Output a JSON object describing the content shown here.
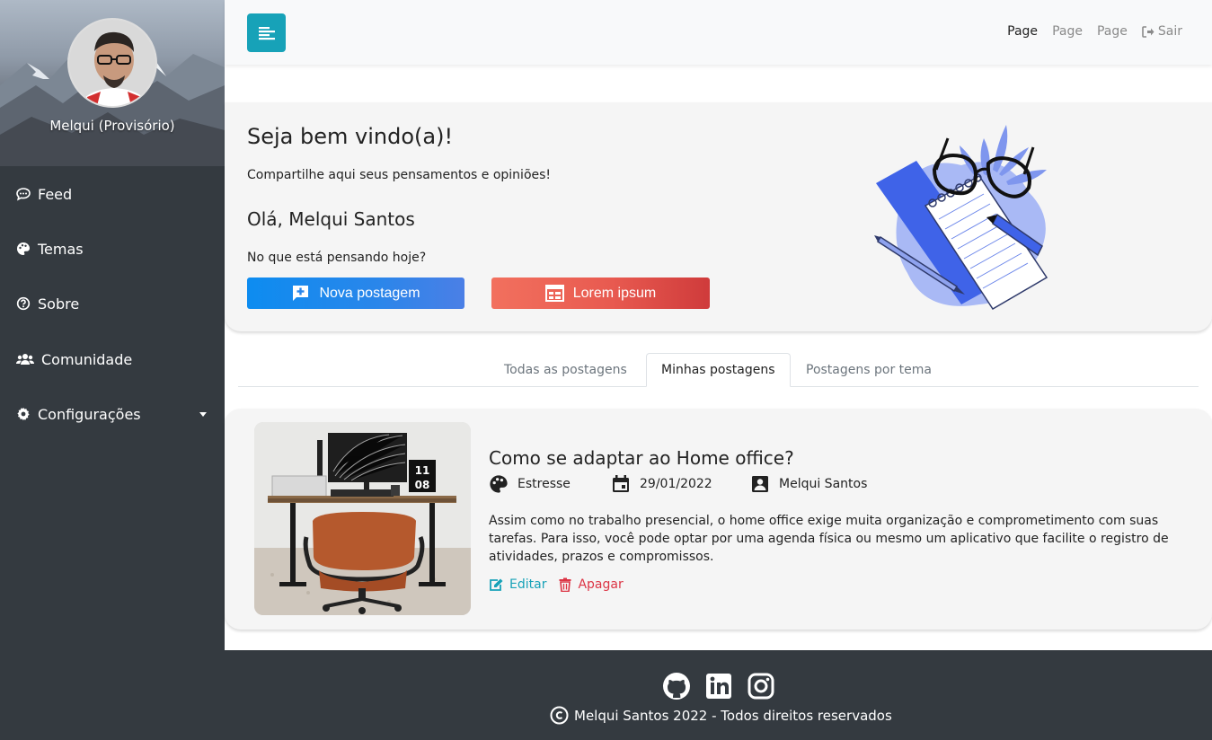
{
  "sidebar": {
    "profile_name": "Melqui (Provisório)",
    "items": [
      {
        "label": "Feed",
        "icon": "comment-icon"
      },
      {
        "label": "Temas",
        "icon": "palette-icon"
      },
      {
        "label": "Sobre",
        "icon": "question-circle-icon"
      },
      {
        "label": "Comunidade",
        "icon": "users-icon"
      },
      {
        "label": "Configurações",
        "icon": "gear-icon"
      }
    ]
  },
  "topbar": {
    "links": [
      "Page",
      "Page",
      "Page"
    ],
    "logout_label": "Sair",
    "menu_color": "#17a2b8"
  },
  "welcome": {
    "title": "Seja bem vindo(a)!",
    "subtitle": "Compartilhe aqui seus pensamentos e opiniões!",
    "greeting": "Olá, Melqui Santos",
    "question": "No que está pensando hoje?",
    "new_post_label": "Nova postagem",
    "lorem_label": "Lorem ipsum"
  },
  "tabs": [
    {
      "label": "Todas as postagens",
      "active": false
    },
    {
      "label": "Minhas postagens",
      "active": true
    },
    {
      "label": "Postagens por tema",
      "active": false
    }
  ],
  "post": {
    "title": "Como se adaptar ao Home office?",
    "theme": "Estresse",
    "date": "29/01/2022",
    "author": "Melqui Santos",
    "text": "Assim como no trabalho presencial, o home office exige muita organização e comprometimento com suas tarefas. Para isso, você pode optar por uma agenda física ou mesmo um aplicativo que facilite o registro de atividades, prazos e compromissos.",
    "edit_label": "Editar",
    "delete_label": "Apagar",
    "clock_top": "11",
    "clock_bottom": "08"
  },
  "footer": {
    "copyright": "Melqui Santos 2022 - Todos direitos reservados",
    "socials": [
      "github-icon",
      "linkedin-icon",
      "instagram-icon"
    ]
  },
  "colors": {
    "sidebar": "#343a40",
    "primary_blue": "#0d8cf0",
    "danger_red": "#dc3545",
    "info_teal": "#17a2b8"
  }
}
